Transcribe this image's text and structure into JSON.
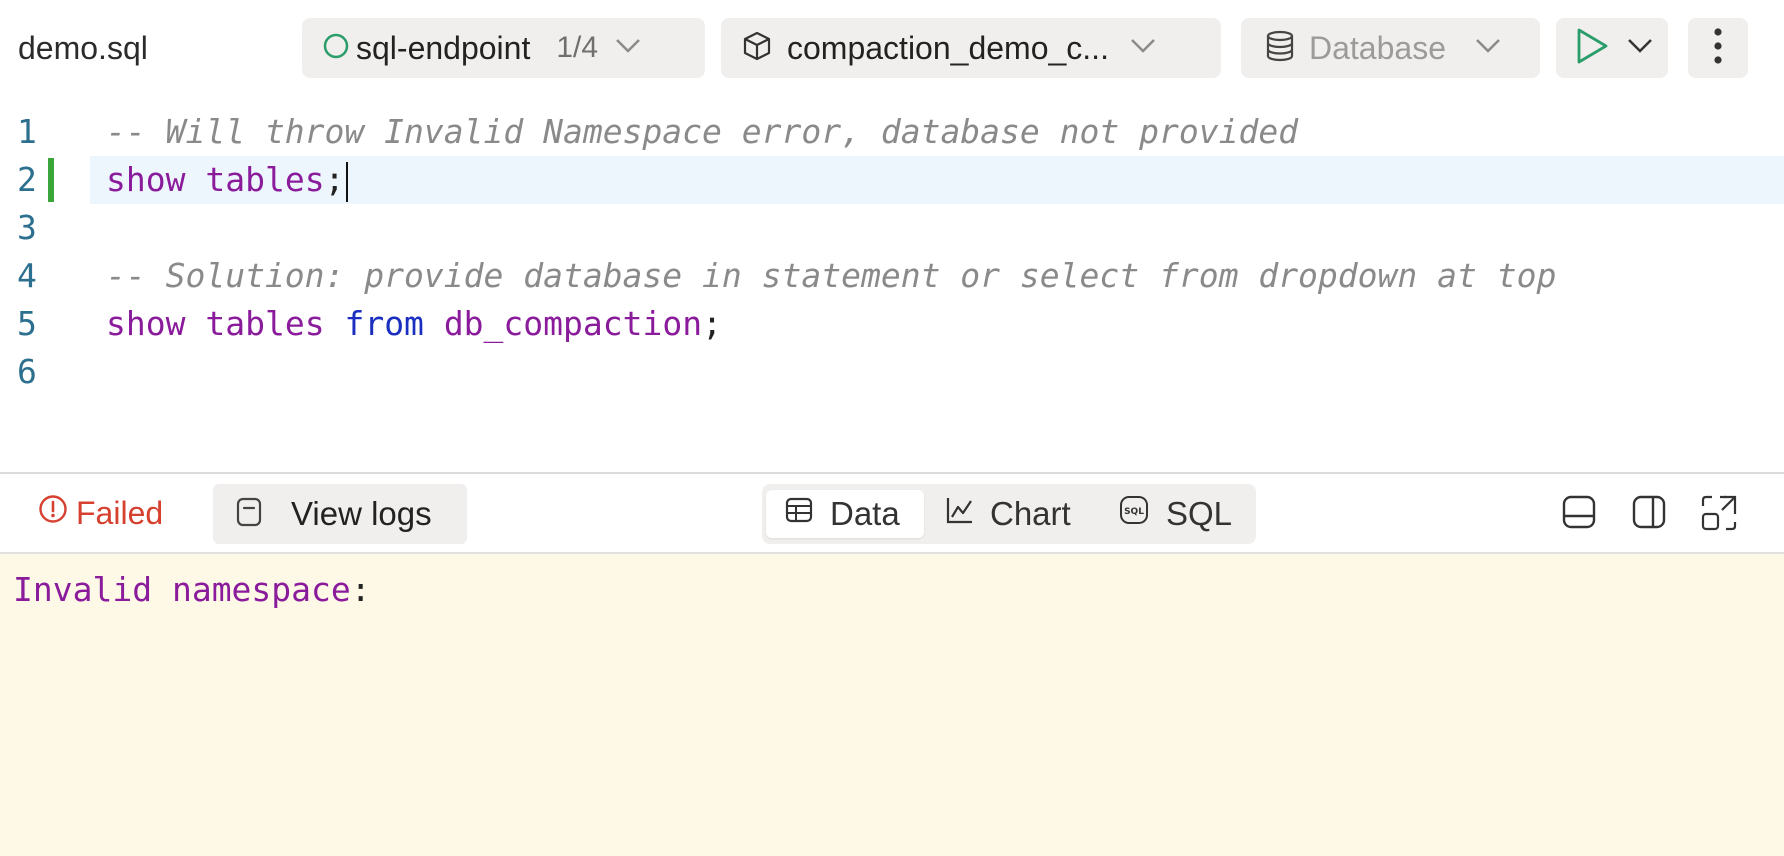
{
  "header": {
    "file_name": "demo.sql",
    "endpoint": {
      "label": "sql-endpoint",
      "count": "1/4",
      "status_color": "#2a9d6b"
    },
    "catalog": {
      "label": "compaction_demo_c..."
    },
    "database": {
      "placeholder": "Database"
    },
    "run_color": "#2a9d6b"
  },
  "editor": {
    "lines": [
      {
        "num": "1",
        "comment": "-- Will throw Invalid Namespace error, database not provided"
      },
      {
        "num": "2",
        "kw1": "show",
        "kw2": "tables",
        "punct": ";"
      },
      {
        "num": "3"
      },
      {
        "num": "4",
        "comment": "-- Solution: provide database in statement or select from dropdown at top"
      },
      {
        "num": "5",
        "kw1": "show",
        "kw2": "tables",
        "kw3": "from",
        "ident": "db_compaction",
        "punct": ";"
      },
      {
        "num": "6"
      }
    ]
  },
  "results": {
    "status": "Failed",
    "status_color": "#d6402f",
    "view_logs": "View logs",
    "tabs": [
      {
        "label": "Data",
        "icon": "table-icon",
        "selected": true
      },
      {
        "label": "Chart",
        "icon": "chart-icon",
        "selected": false
      },
      {
        "label": "SQL",
        "icon": "sql-icon",
        "selected": false
      }
    ],
    "layout_icons": [
      "split-horizontal-icon",
      "split-vertical-icon",
      "expand-icon"
    ]
  },
  "output": {
    "word1": "Invalid",
    "word2": "namespace",
    "punct": ":",
    "background": "#fef9e7"
  }
}
